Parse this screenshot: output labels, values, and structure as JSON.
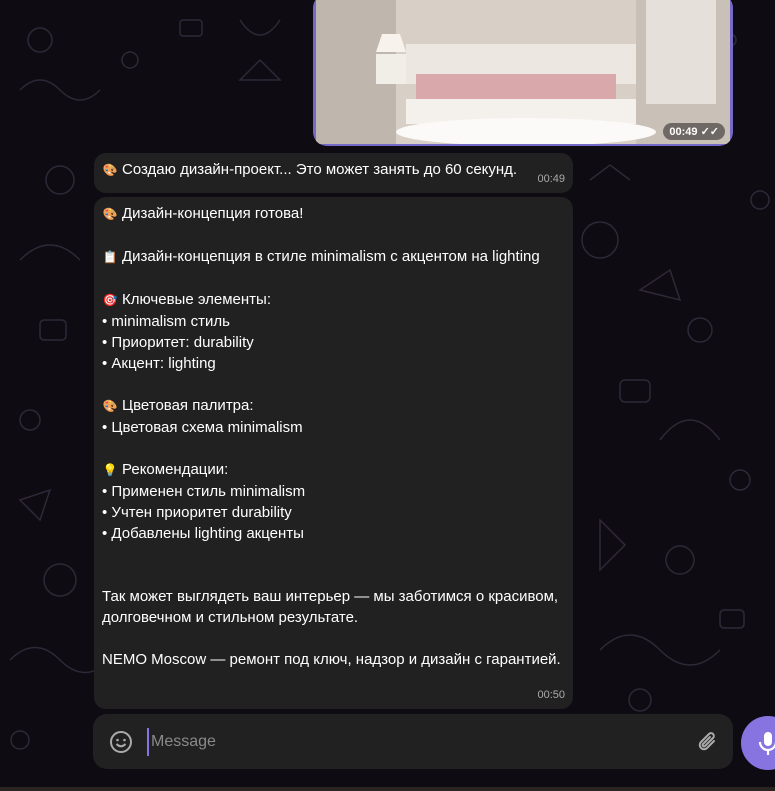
{
  "photo": {
    "time": "00:49",
    "status_icon": "double-check-icon"
  },
  "messages": [
    {
      "lines": [
        "Создаю дизайн-проект... Это может занять до 60 секунд."
      ],
      "emojis": [
        "🎨"
      ],
      "time": "00:49"
    },
    {
      "time": "00:50",
      "lines": [
        {
          "emoji": "🎨",
          "text": "Дизайн-концепция готова!"
        },
        {
          "text": ""
        },
        {
          "emoji": "📋",
          "text": "Дизайн-концепция в стиле minimalism с акцентом на lighting"
        },
        {
          "text": ""
        },
        {
          "emoji": "🎯",
          "text": "Ключевые элементы:"
        },
        {
          "text": "• minimalism стиль"
        },
        {
          "text": "• Приоритет: durability"
        },
        {
          "text": "• Акцент: lighting"
        },
        {
          "text": ""
        },
        {
          "emoji": "🎨",
          "text": "Цветовая палитра:"
        },
        {
          "text": "• Цветовая схема minimalism"
        },
        {
          "text": ""
        },
        {
          "emoji": "💡",
          "text": "Рекомендации:"
        },
        {
          "text": "• Применен стиль minimalism"
        },
        {
          "text": "• Учтен приоритет durability"
        },
        {
          "text": "• Добавлены lighting акценты"
        },
        {
          "text": ""
        },
        {
          "text": ""
        },
        {
          "text": "Так может выглядеть ваш интерьер — мы заботимся о красивом, долговечном и стильном результате."
        },
        {
          "text": ""
        },
        {
          "text": "NEMO Moscow — ремонт под ключ, надзор и дизайн с гарантией."
        }
      ]
    }
  ],
  "composer": {
    "placeholder": "Message",
    "emoji_icon": "smile-icon",
    "attach_icon": "paperclip-icon",
    "send_icon": "microphone-icon"
  },
  "colors": {
    "accent": "#8774e1",
    "bubble": "#212121",
    "background": "#0e0c12"
  }
}
